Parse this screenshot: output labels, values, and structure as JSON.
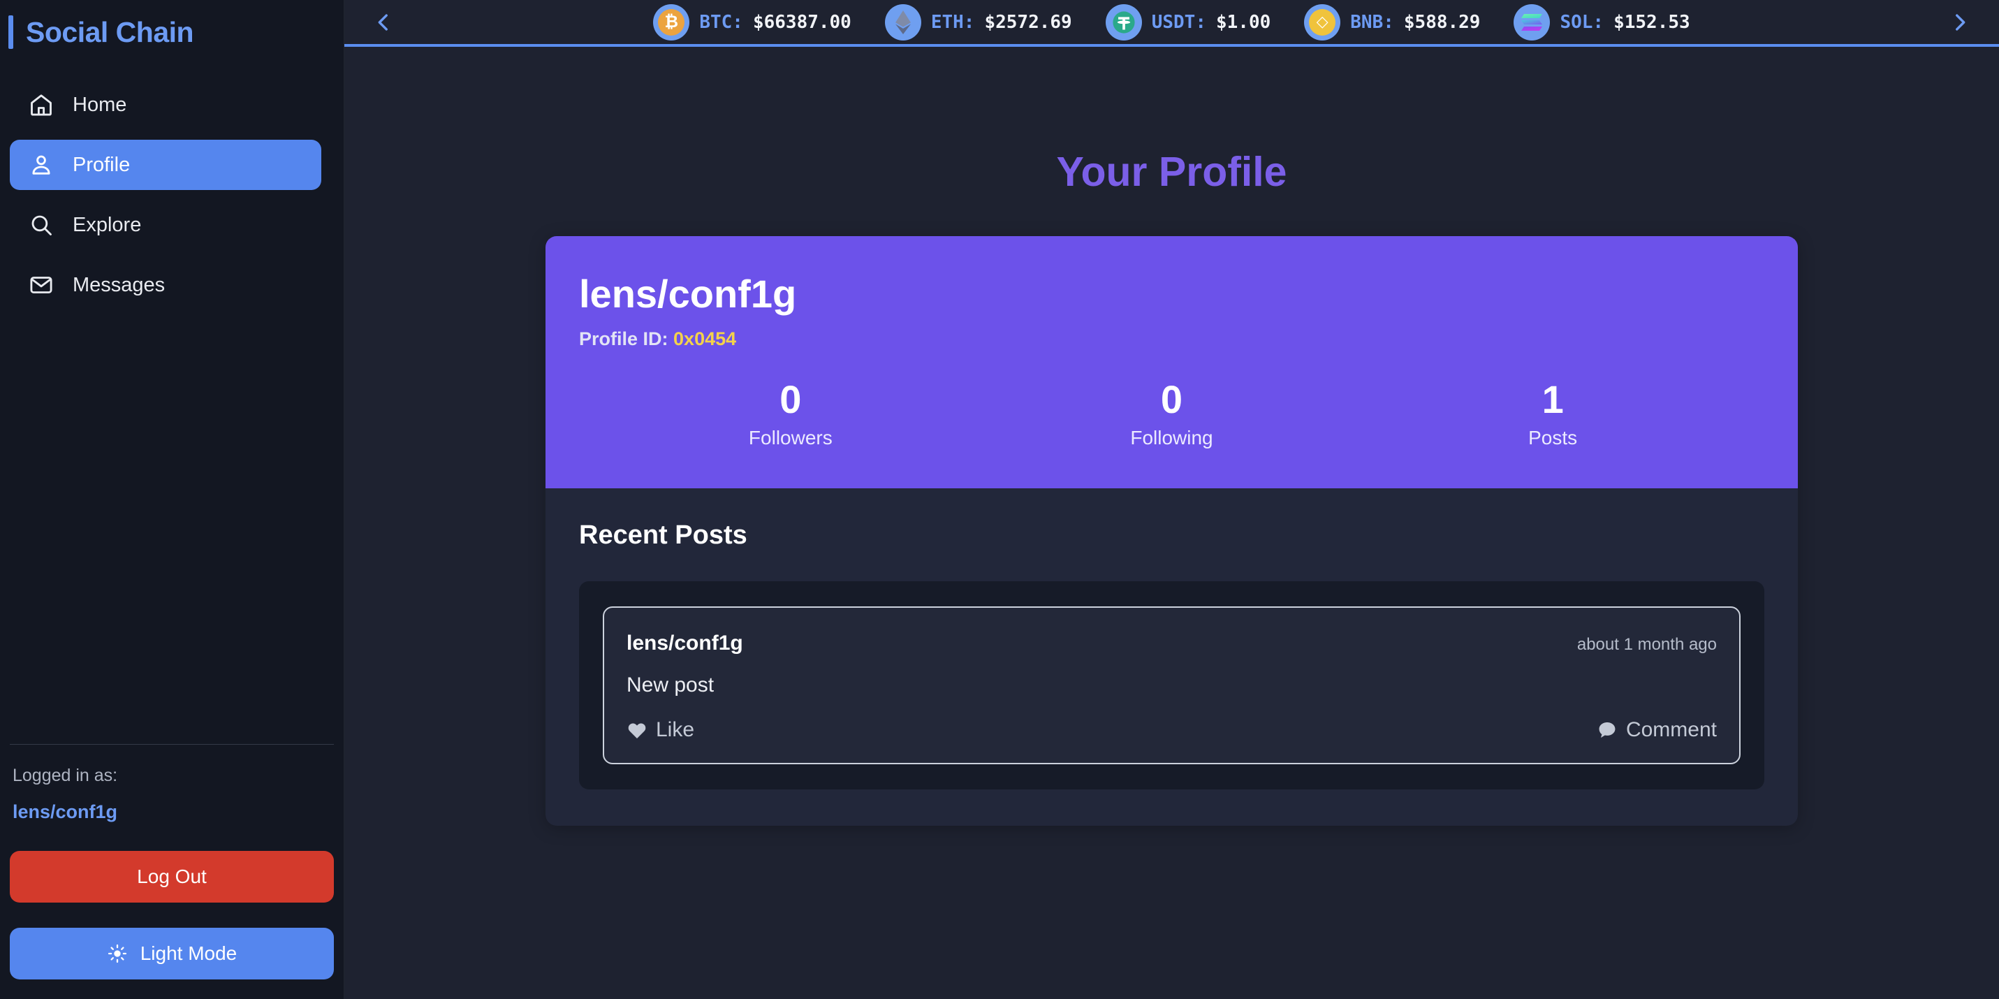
{
  "app": {
    "brand": "Social Chain",
    "accent_blue": "#5586ee",
    "accent_purple": "#6c52ea",
    "title_purple": "#7b5fe8",
    "danger_red": "#d33a2c",
    "gold": "#f4d24b"
  },
  "sidebar": {
    "nav": [
      {
        "label": "Home",
        "icon": "home-icon",
        "active": false
      },
      {
        "label": "Profile",
        "icon": "person-icon",
        "active": true
      },
      {
        "label": "Explore",
        "icon": "search-icon",
        "active": false
      },
      {
        "label": "Messages",
        "icon": "envelope-icon",
        "active": false
      }
    ],
    "logged_in_label": "Logged in as:",
    "logged_in_handle": "lens/conf1g",
    "logout_label": "Log Out",
    "theme_toggle_label": "Light Mode",
    "theme_toggle_icon": "sun-icon"
  },
  "ticker": {
    "prev_icon": "chevron-left-icon",
    "next_icon": "chevron-right-icon",
    "items": [
      {
        "symbol": "BTC:",
        "price": "$66387.00",
        "icon": "bitcoin-icon",
        "color": "#eca33f"
      },
      {
        "symbol": "ETH:",
        "price": "$2572.69",
        "icon": "ethereum-icon",
        "color": "#6f7fa8"
      },
      {
        "symbol": "USDT:",
        "price": "$1.00",
        "icon": "tether-icon",
        "color": "#28b08c"
      },
      {
        "symbol": "BNB:",
        "price": "$588.29",
        "icon": "binance-icon",
        "color": "#f0c33c"
      },
      {
        "symbol": "SOL:",
        "price": "$152.53",
        "icon": "solana-icon",
        "color": "#9945ff"
      }
    ]
  },
  "main": {
    "page_title": "Your Profile",
    "profile": {
      "handle": "lens/conf1g",
      "profile_id_label": "Profile ID:",
      "profile_id_value": "0x0454",
      "stats": [
        {
          "value": "0",
          "label": "Followers"
        },
        {
          "value": "0",
          "label": "Following"
        },
        {
          "value": "1",
          "label": "Posts"
        }
      ]
    },
    "recent_posts_title": "Recent Posts",
    "posts": [
      {
        "author": "lens/conf1g",
        "time": "about 1 month ago",
        "body": "New post",
        "like_label": "Like",
        "like_icon": "heart-icon",
        "comment_label": "Comment",
        "comment_icon": "comment-icon"
      }
    ]
  }
}
